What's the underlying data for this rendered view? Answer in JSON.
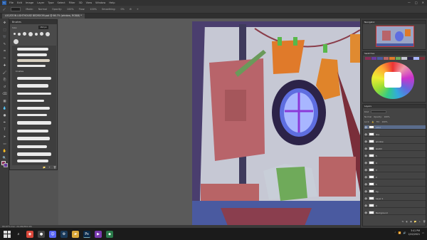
{
  "app": {
    "name": "Photoshop",
    "logo": "Ps",
    "menu": [
      "File",
      "Edit",
      "Image",
      "Layer",
      "Type",
      "Select",
      "Filter",
      "3D",
      "View",
      "Window",
      "Help"
    ],
    "window_controls": [
      "—",
      "□",
      "✕"
    ]
  },
  "options": {
    "items": [
      "Mode:",
      "Normal",
      "Opacity:",
      "100%",
      "Flow:",
      "100%",
      "Smoothing:",
      "0%"
    ]
  },
  "document": {
    "tab_title": "LOCATION LIGHTHOUSE BEDROOM.psd @ 66.7% (window, RGB/8) *"
  },
  "toolbar": {
    "icons": [
      "move-icon",
      "marquee-icon",
      "lasso-icon",
      "quick-select-icon",
      "crop-icon",
      "eyedropper-icon",
      "healing-icon",
      "brush-icon",
      "clone-stamp-icon",
      "history-brush-icon",
      "eraser-icon",
      "gradient-icon",
      "blur-icon",
      "dodge-icon",
      "pen-icon",
      "type-icon",
      "path-select-icon",
      "rectangle-icon",
      "hand-icon",
      "zoom-icon"
    ],
    "glyphs": [
      "✥",
      "⬚",
      "➰",
      "✎",
      "⌗",
      "✑",
      "✚",
      "🖌",
      "⎘",
      "↺",
      "⌫",
      "▦",
      "💧",
      "●",
      "✒",
      "T",
      "➤",
      "▭",
      "✋",
      "🔍"
    ],
    "fg_color": "#8a2d55",
    "bg_color": "#6a3aa0"
  },
  "brushes_panel": {
    "title": "Brushes",
    "size_label": "Size:",
    "size_value": "162 px",
    "folder_label": "brushes",
    "footer_icons": [
      "📁",
      "+",
      "🗑"
    ]
  },
  "statusbar": {
    "text": "66.67%    Doc: 24.9M/383.5M"
  },
  "navigator": {
    "title": "Navigator"
  },
  "swatches": {
    "title": "Swatches"
  },
  "layers": {
    "title": "Layers",
    "kind_label": "Kind",
    "blend_mode": "Normal",
    "opacity_label": "Opacity:",
    "opacity": "100%",
    "lock_label": "Lock:",
    "fill_label": "Fill:",
    "fill": "100%",
    "rows": [
      {
        "name": "color"
      },
      {
        "name": "line"
      },
      {
        "name": "window"
      },
      {
        "name": "sketch"
      },
      {
        "name": "5"
      },
      {
        "name": "4"
      },
      {
        "name": "3"
      },
      {
        "name": "2"
      },
      {
        "name": "1"
      },
      {
        "name": "bg"
      },
      {
        "name": "Layer 1"
      },
      {
        "name": "0"
      },
      {
        "name": "Background"
      }
    ],
    "footer_icons": [
      "fx",
      "◐",
      "▣",
      "📁",
      "+",
      "🗑"
    ]
  },
  "taskbar": {
    "apps": [
      {
        "name": "search-icon",
        "glyph": "⌕",
        "color": "#1b1b1b"
      },
      {
        "name": "chrome-icon",
        "glyph": "◉",
        "color": "#d9473a"
      },
      {
        "name": "obs-icon",
        "glyph": "●",
        "color": "#444"
      },
      {
        "name": "discord-icon",
        "glyph": "☺",
        "color": "#5865f2"
      },
      {
        "name": "steam-icon",
        "glyph": "⚙",
        "color": "#1a3a5a"
      },
      {
        "name": "folder-icon",
        "glyph": "▰",
        "color": "#d9a83a"
      },
      {
        "name": "photoshop-icon",
        "glyph": "Ps",
        "color": "#0a2a4a"
      },
      {
        "name": "media-icon",
        "glyph": "▶",
        "color": "#7a3ab0"
      },
      {
        "name": "app-icon",
        "glyph": "◆",
        "color": "#2a7a4a"
      }
    ],
    "time": "3:41 PM",
    "date": "2/22/2021"
  },
  "colors": {
    "accent": "#5a6c8c",
    "app_bg": "#535353",
    "panel_bg": "#444444"
  }
}
